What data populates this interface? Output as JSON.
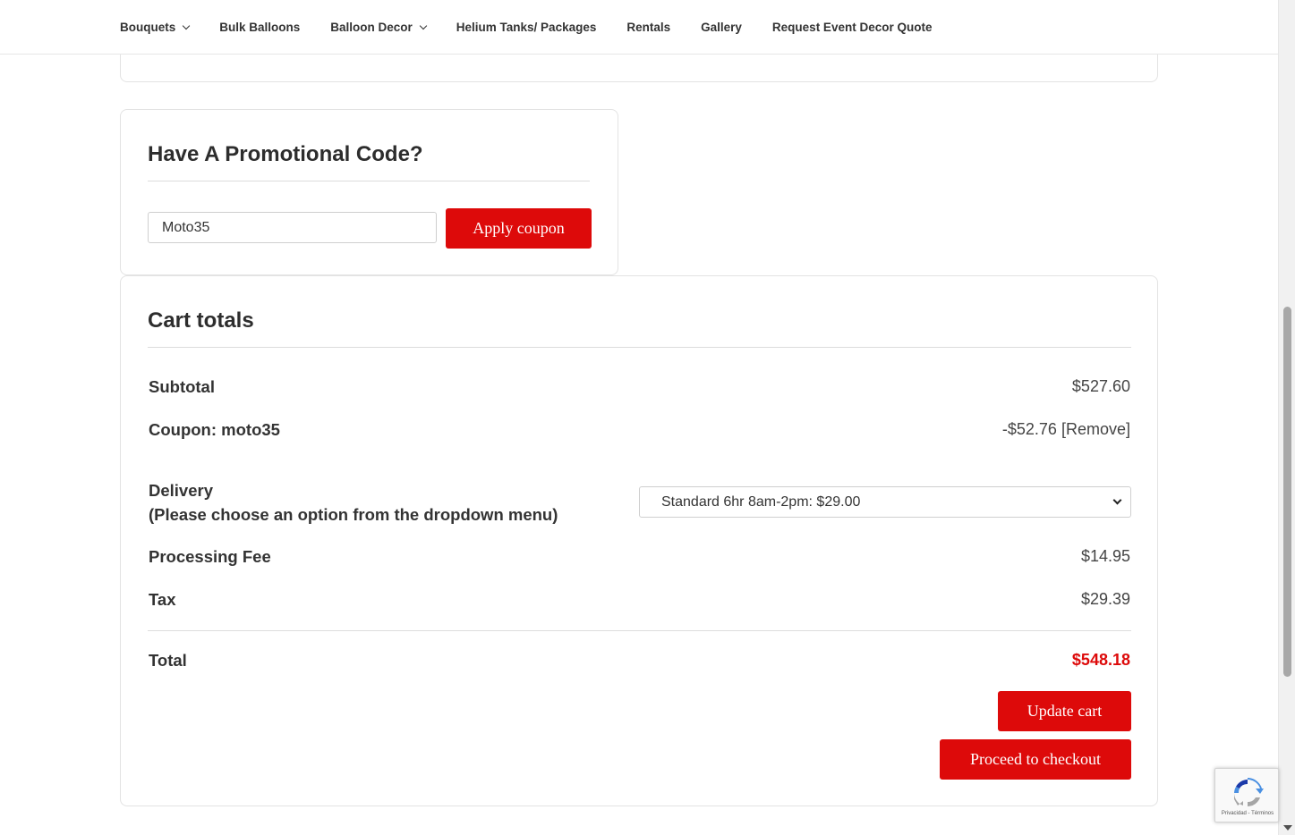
{
  "nav": {
    "items": [
      {
        "label": "Bouquets",
        "has_dropdown": true
      },
      {
        "label": "Bulk Balloons",
        "has_dropdown": false
      },
      {
        "label": "Balloon Decor",
        "has_dropdown": true
      },
      {
        "label": "Helium Tanks/ Packages",
        "has_dropdown": false
      },
      {
        "label": "Rentals",
        "has_dropdown": false
      },
      {
        "label": "Gallery",
        "has_dropdown": false
      },
      {
        "label": "Request Event Decor Quote",
        "has_dropdown": false
      }
    ]
  },
  "promo": {
    "title": "Have A Promotional Code?",
    "coupon_value": "Moto35",
    "apply_label": "Apply coupon"
  },
  "totals": {
    "title": "Cart totals",
    "subtotal_label": "Subtotal",
    "subtotal_value": "$527.60",
    "coupon_label": "Coupon: moto35",
    "coupon_value": "-$52.76",
    "coupon_remove": "[Remove]",
    "delivery_label": "Delivery",
    "delivery_hint": "(Please choose an option from the dropdown menu)",
    "delivery_selected": "Standard 6hr 8am-2pm: $29.00",
    "processing_label": "Processing Fee",
    "processing_value": "$14.95",
    "tax_label": "Tax",
    "tax_value": "$29.39",
    "total_label": "Total",
    "total_value": "$548.18",
    "update_label": "Update cart",
    "checkout_label": "Proceed to checkout"
  },
  "recaptcha": {
    "icon": "recaptcha-logo",
    "footer": "Privacidad - Términos"
  },
  "colors": {
    "accent": "#dd0a0a",
    "text": "#333333",
    "border": "#e3e3e3"
  }
}
